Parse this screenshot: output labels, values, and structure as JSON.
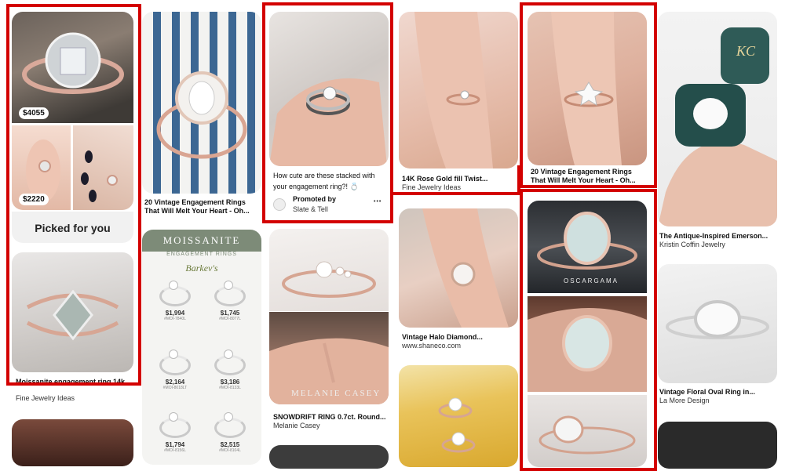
{
  "colors": {
    "highlight": "#d30000",
    "background": "#ffffff"
  },
  "col1": {
    "price1": "$4055",
    "price2": "$2220",
    "picked": "Picked for you",
    "pin2_title": "Moissanite engagement ring 14k...",
    "pin2_source": "Fine Jewelry Ideas"
  },
  "col2": {
    "pin1_title_l1": "20 Vintage Engagement Rings",
    "pin1_title_l2": "That Will Melt Your Heart - Oh...",
    "moissanite": {
      "header": "MOISSANITE",
      "subheader": "ENGAGEMENT RINGS",
      "brand": "Barkev's",
      "items": [
        {
          "price": "$1,994",
          "sku": "#MOI-7840L"
        },
        {
          "price": "$1,745",
          "sku": "#MOI-8077L"
        },
        {
          "price": "$2,164",
          "sku": "#MOI-8018LT"
        },
        {
          "price": "$3,186",
          "sku": "#MOI-8133L"
        },
        {
          "price": "$1,794",
          "sku": "#MOI-8156L"
        },
        {
          "price": "$2,515",
          "sku": "#MOI-8104L"
        }
      ]
    }
  },
  "col3": {
    "pin1_title_l1": "How cute are these stacked with",
    "pin1_title_l2": "your engagement ring?! 💍",
    "promoted_by": "Promoted by",
    "promoter": "Slate & Tell",
    "more": "•••",
    "watermark": "MELANIE CASEY",
    "pin2_title": "SNOWDRIFT RING 0.7ct. Round...",
    "pin2_source": "Melanie Casey"
  },
  "col4": {
    "pin1_title": "14K Rose Gold fill Twist...",
    "pin1_source": "Fine Jewelry Ideas",
    "pin2_title": "Vintage Halo Diamond...",
    "pin2_source": "www.shaneco.com"
  },
  "col5": {
    "pin1_title_l1": "20 Vintage Engagement Rings",
    "pin1_title_l2": "That Will Melt Your Heart - Oh...",
    "oscar": "OSCARGAMA"
  },
  "col6": {
    "box_initials": "KC",
    "pin1_title": "The Antique-Inspired Emerson...",
    "pin1_source": "Kristin Coffin Jewelry",
    "pin2_title": "Vintage Floral Oval Ring in...",
    "pin2_source": "La More Design"
  }
}
